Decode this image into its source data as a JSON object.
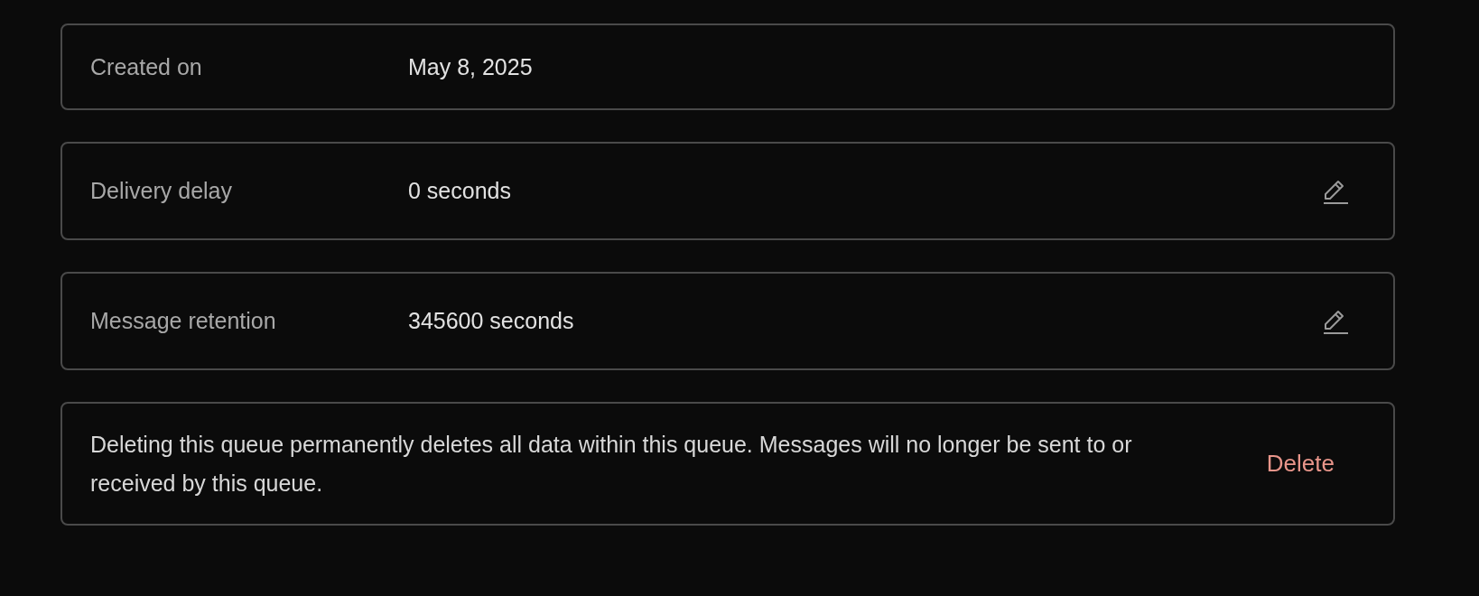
{
  "settings": [
    {
      "kind": "field",
      "label": "Created on",
      "value": "May 8, 2025",
      "editable": false
    },
    {
      "kind": "field",
      "label": "Delivery delay",
      "value": "0 seconds",
      "editable": true
    },
    {
      "kind": "field",
      "label": "Message retention",
      "value": "345600 seconds",
      "editable": true
    },
    {
      "kind": "danger",
      "text": "Deleting this queue permanently deletes all data within this queue. Messages will no longer be sent to or received by this queue.",
      "action": "Delete"
    }
  ]
}
